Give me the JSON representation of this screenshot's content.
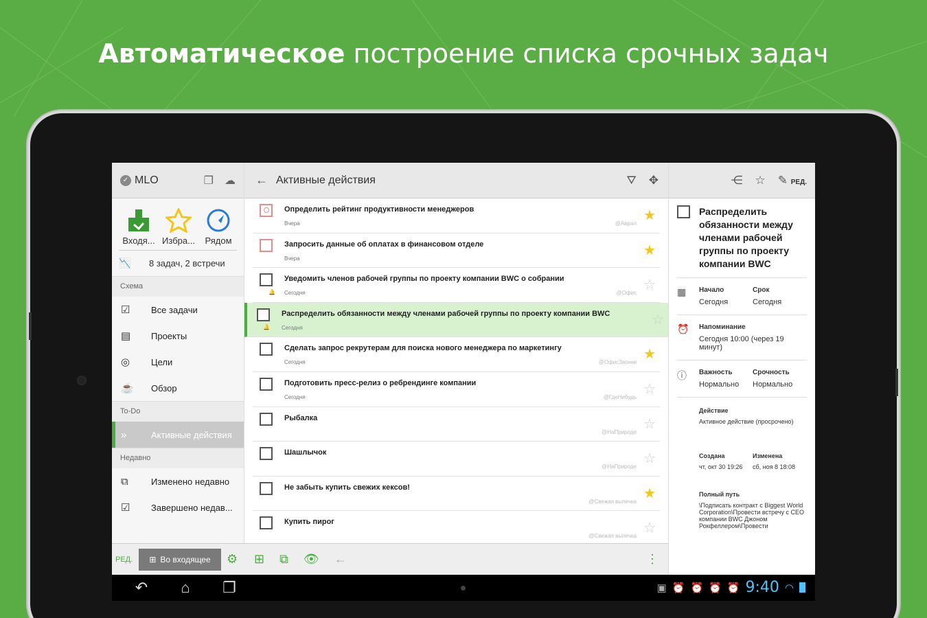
{
  "headline": {
    "bold": "Автоматическое",
    "rest": "построение списка срочных задач"
  },
  "left": {
    "app_name": "MLO",
    "quick": [
      {
        "label": "Входя...",
        "icon": "inbox-icon"
      },
      {
        "label": "Избра...",
        "icon": "star-icon"
      },
      {
        "label": "Рядом",
        "icon": "compass-icon"
      }
    ],
    "summary": "8 задач, 2 встречи",
    "section_schema": "Схема",
    "schema_items": [
      "Все задачи",
      "Проекты",
      "Цели",
      "Обзор"
    ],
    "section_todo": "To-Do",
    "todo_items": [
      "Активные действия"
    ],
    "section_recent": "Недавно",
    "recent_items": [
      "Изменено недавно",
      "Завершено недав..."
    ],
    "edit_label": "РЕД.",
    "inbox_button": "Во входящее"
  },
  "mid": {
    "title": "Активные действия",
    "tasks": [
      {
        "title": "Определить рейтинг продуктивности менеджеров",
        "date": "Вчера",
        "context": "@Аврал",
        "starred": true
      },
      {
        "title": "Запросить данные об оплатах в финансовом отделе",
        "date": "Вчера",
        "context": "",
        "starred": true
      },
      {
        "title": "Уведомить членов рабочей группы по проекту компании BWC о собрании",
        "date": "Сегодня",
        "context": "@Офис",
        "starred": false
      },
      {
        "title": "Распределить обязанности между членами рабочей группы по проекту компании BWC",
        "date": "Сегодня",
        "context": "",
        "starred": false
      },
      {
        "title": "Сделать запрос рекрутерам для поиска нового менеджера по маркетингу",
        "date": "Сегодня",
        "context": "@ОфисЗвонки",
        "starred": true
      },
      {
        "title": "Подготовить пресс-релиз о ребрендинге компании",
        "date": "Сегодня",
        "context": "@ГдеНибудь",
        "starred": false
      },
      {
        "title": "Рыбалка",
        "date": "",
        "context": "@НаПрироде",
        "starred": false
      },
      {
        "title": "Шашлычок",
        "date": "",
        "context": "@НаПрироде",
        "starred": false
      },
      {
        "title": "Не забыть купить свежих кексов!",
        "date": "",
        "context": "@Свежая выпечка",
        "starred": true
      },
      {
        "title": "Купить пирог",
        "date": "",
        "context": "@Свежая выпечка",
        "starred": false
      }
    ]
  },
  "right": {
    "edit_label": "РЕД.",
    "task_title": "Распределить обязанности между членами рабочей группы по проекту компании BWC",
    "start_label": "Начало",
    "start_value": "Сегодня",
    "due_label": "Срок",
    "due_value": "Сегодня",
    "reminder_label": "Напоминание",
    "reminder_value": "Сегодня 10:00 (через 19 минут)",
    "importance_label": "Важность",
    "importance_value": "Нормально",
    "urgency_label": "Срочность",
    "urgency_value": "Нормально",
    "action_label": "Действие",
    "action_value": "Активное действие (просрочено)",
    "created_label": "Создана",
    "created_value": "чт, окт 30 19:26",
    "modified_label": "Изменена",
    "modified_value": "сб, ноя 8 18:08",
    "path_label": "Полный путь",
    "path_value": "\\Подписать контракт с Biggest World Corporation\\Провести встречу с CEO компании BWC Джоном Рокфеллером\\Провести"
  },
  "status": {
    "time": "9:40"
  },
  "colors": {
    "green": "#5aad45",
    "accent": "#4aae3f",
    "star": "#f5c518",
    "clock": "#4fc3f7"
  }
}
